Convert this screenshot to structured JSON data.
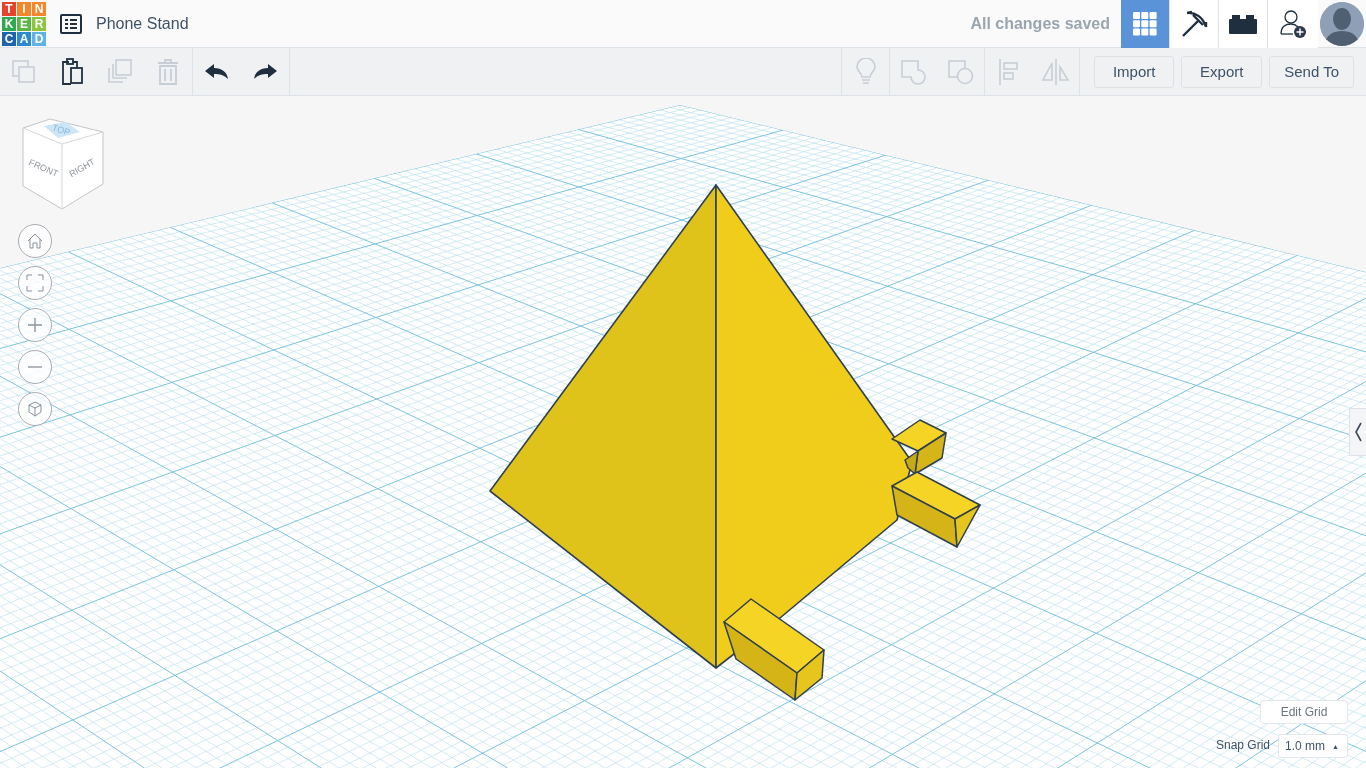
{
  "logo": {
    "letters": [
      {
        "char": "T",
        "color": "#e8432d"
      },
      {
        "char": "I",
        "color": "#f5862a"
      },
      {
        "char": "N",
        "color": "#f5862a"
      },
      {
        "char": "K",
        "color": "#2fa84f"
      },
      {
        "char": "E",
        "color": "#5db548"
      },
      {
        "char": "R",
        "color": "#8cc63f"
      },
      {
        "char": "C",
        "color": "#1e63b0"
      },
      {
        "char": "A",
        "color": "#2d8ad0"
      },
      {
        "char": "D",
        "color": "#5fb2e3"
      }
    ]
  },
  "project": {
    "title": "Phone Stand"
  },
  "save_status": "All changes saved",
  "view_tabs": [
    {
      "kind": "grid",
      "selected": true
    },
    {
      "kind": "pickaxe",
      "selected": false
    },
    {
      "kind": "bricks",
      "selected": false
    }
  ],
  "toolbar": {
    "edit_tools": [
      {
        "kind": "copy",
        "disabled": true
      },
      {
        "kind": "paste",
        "disabled": false
      },
      {
        "kind": "duplicate",
        "disabled": true
      },
      {
        "kind": "delete",
        "disabled": true
      }
    ],
    "history": [
      {
        "kind": "undo",
        "disabled": false
      },
      {
        "kind": "redo",
        "disabled": false
      }
    ],
    "shape_tools": [
      {
        "kind": "bulb",
        "disabled": true
      },
      {
        "kind": "group",
        "disabled": true
      },
      {
        "kind": "ungroup",
        "disabled": true
      },
      {
        "kind": "align",
        "disabled": true
      },
      {
        "kind": "mirror",
        "disabled": true
      }
    ],
    "actions": [
      "Import",
      "Export",
      "Send To"
    ]
  },
  "view_cube": {
    "faces": [
      "TOP",
      "FRONT",
      "RIGHT"
    ]
  },
  "view_controls": [
    {
      "kind": "home"
    },
    {
      "kind": "fit"
    },
    {
      "kind": "zoom-in"
    },
    {
      "kind": "zoom-out"
    },
    {
      "kind": "perspective"
    }
  ],
  "grid": {
    "edit_label": "Edit Grid",
    "snap_label": "Snap Grid",
    "snap_value": "1.0 mm",
    "caret": "▲"
  }
}
